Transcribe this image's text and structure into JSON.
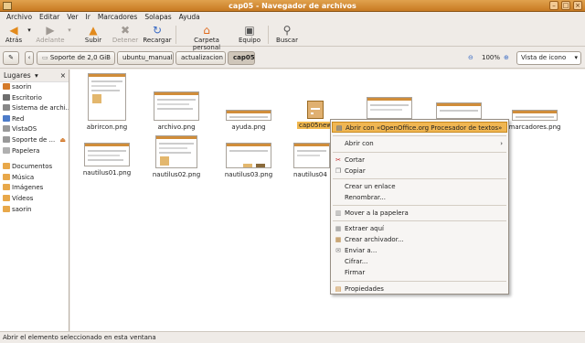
{
  "window": {
    "title": "cap05 - Navegador de archivos"
  },
  "menu": [
    "Archivo",
    "Editar",
    "Ver",
    "Ir",
    "Marcadores",
    "Solapas",
    "Ayuda"
  ],
  "toolbar": {
    "back": "Atrás",
    "forward": "Adelante",
    "up": "Subir",
    "stop": "Detener",
    "reload": "Recargar",
    "home": "Carpeta personal",
    "computer": "Equipo",
    "search": "Buscar"
  },
  "location": {
    "path": [
      "Soporte de 2,0 GiB",
      "ubuntu_manual",
      "actualizacion",
      "cap05"
    ],
    "zoom": "100%",
    "view": "Vista de icono"
  },
  "sidebar": {
    "header": "Lugares",
    "items": [
      "saorin",
      "Escritorio",
      "Sistema de archi...",
      "Red",
      "VistaOS",
      "Soporte de ...",
      "Papelera",
      "Documentos",
      "Música",
      "Imágenes",
      "Vídeos",
      "saorin"
    ]
  },
  "files": [
    {
      "name": "abrircon.png"
    },
    {
      "name": "archivo.png"
    },
    {
      "name": "ayuda.png"
    },
    {
      "name": "cap05new"
    },
    {
      "name": ""
    },
    {
      "name": ""
    },
    {
      "name": "marcadores.png"
    },
    {
      "name": "nautilus01.png"
    },
    {
      "name": "nautilus02.png"
    },
    {
      "name": "nautilus03.png"
    },
    {
      "name": "nautilus04"
    }
  ],
  "context_menu": {
    "items": [
      "Abrir con «OpenOffice.org Procesador de textos»",
      "Abrir con",
      "Cortar",
      "Copiar",
      "Crear un enlace",
      "Renombrar...",
      "Mover a la papelera",
      "Extraer aquí",
      "Crear archivador...",
      "Enviar a...",
      "Cifrar...",
      "Firmar",
      "Propiedades"
    ]
  },
  "status": {
    "text": "Abrir el elemento seleccionado en esta ventana"
  },
  "colors": {
    "accent": "#f0b652",
    "titlebar": "#d08d3a"
  }
}
